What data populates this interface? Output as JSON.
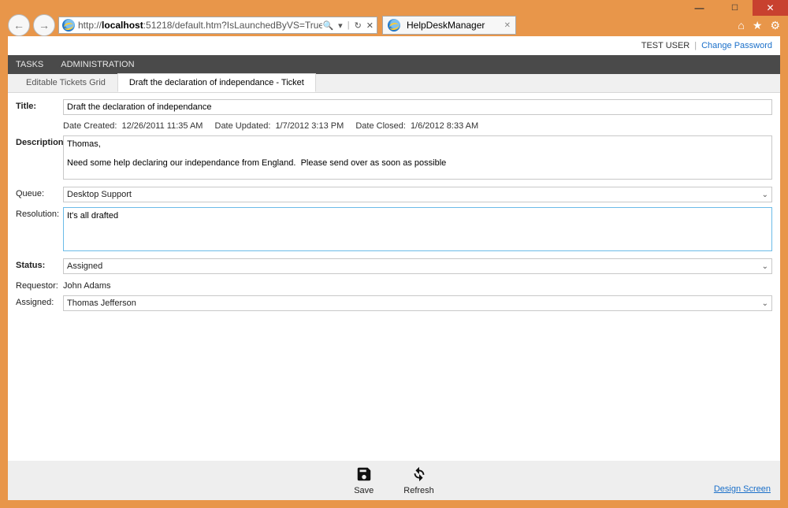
{
  "window": {
    "address": {
      "prefix": "http://",
      "host": "localhost",
      "rest": ":51218/default.htm?IsLaunchedByVS=True"
    },
    "tab_title": "HelpDeskManager"
  },
  "user": {
    "name": "TEST USER",
    "link": "Change Password"
  },
  "menu": {
    "tasks": "TASKS",
    "admin": "ADMINISTRATION"
  },
  "tabs": {
    "grid": "Editable Tickets Grid",
    "ticket": "Draft the declaration of independance - Ticket"
  },
  "form": {
    "title_label": "Title:",
    "title": "Draft the declaration of independance",
    "date_created_label": "Date Created:",
    "date_created": "12/26/2011 11:35 AM",
    "date_updated_label": "Date Updated:",
    "date_updated": "1/7/2012 3:13 PM",
    "date_closed_label": "Date Closed:",
    "date_closed": "1/6/2012 8:33 AM",
    "description_label": "Description:",
    "description": "Thomas,\n\nNeed some help declaring our independance from England.  Please send over as soon as possible",
    "queue_label": "Queue:",
    "queue": "Desktop Support",
    "resolution_label": "Resolution:",
    "resolution": "It's all drafted",
    "status_label": "Status:",
    "status": "Assigned",
    "requestor_label": "Requestor:",
    "requestor": "John Adams",
    "assigned_label": "Assigned:",
    "assigned": "Thomas Jefferson"
  },
  "actions": {
    "save": "Save",
    "refresh": "Refresh",
    "design": "Design Screen"
  }
}
